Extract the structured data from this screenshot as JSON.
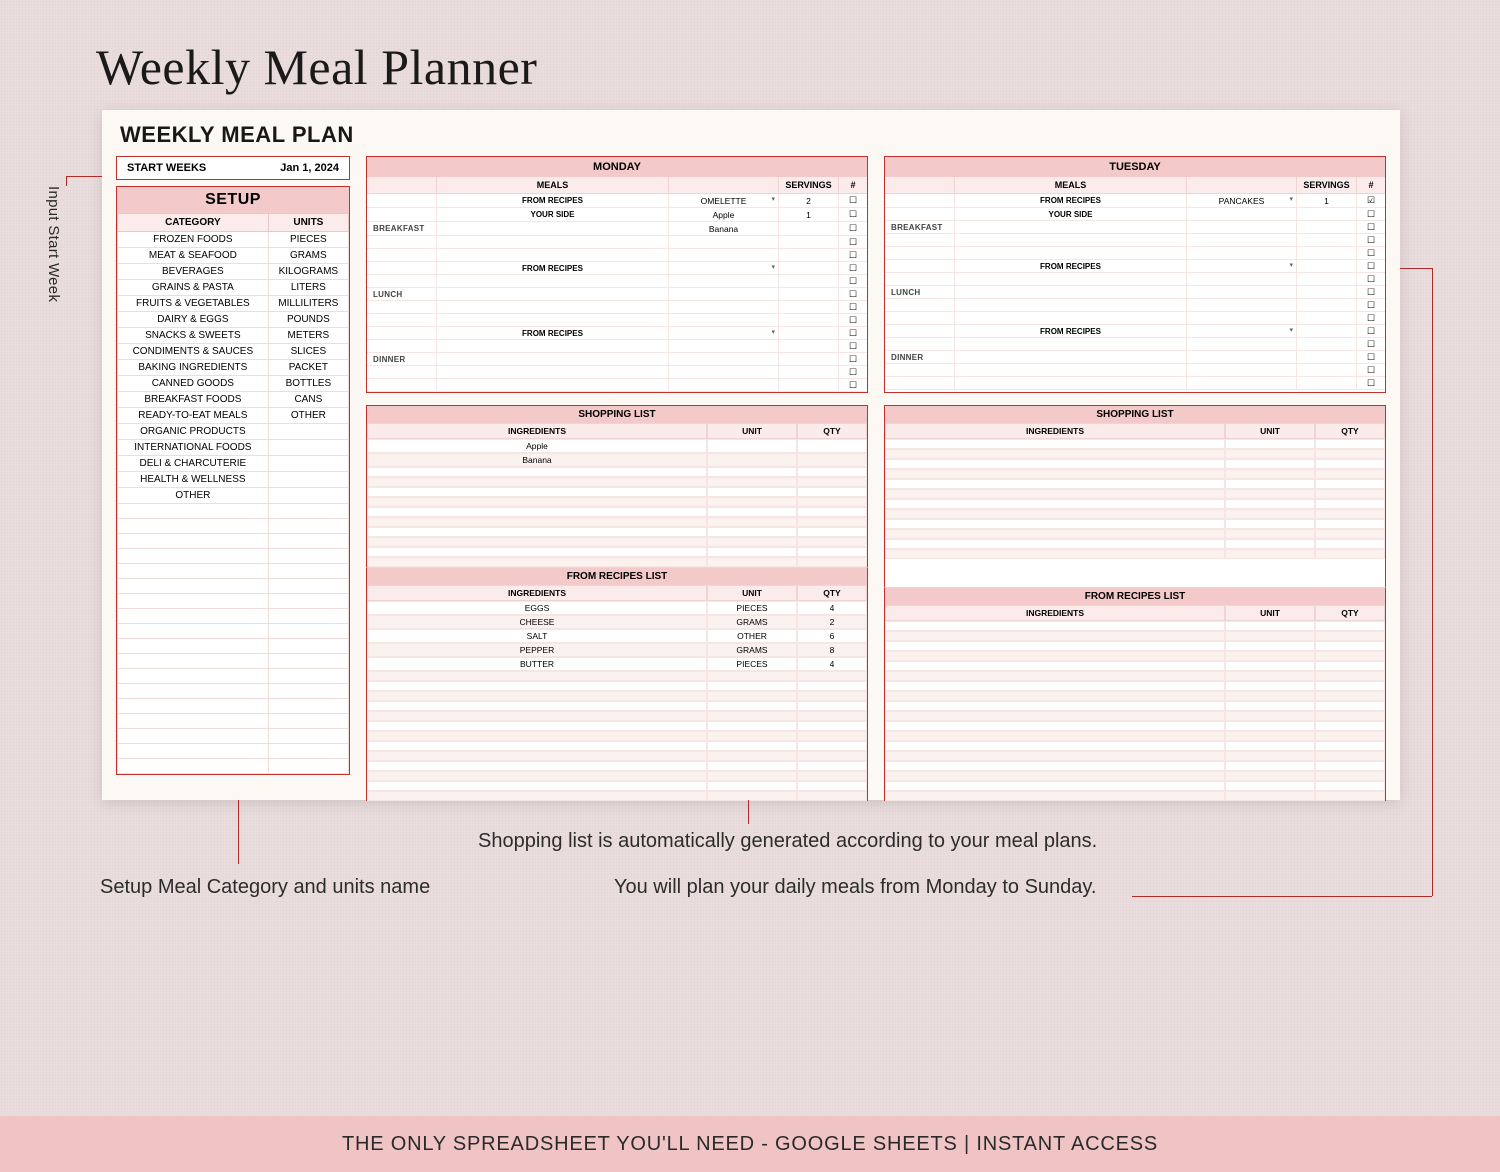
{
  "page": {
    "title": "Weekly Meal Planner",
    "sheet_title": "WEEKLY MEAL PLAN"
  },
  "start": {
    "label": "START WEEKS",
    "value": "Jan 1, 2024"
  },
  "setup": {
    "title": "SETUP",
    "cols": {
      "category": "CATEGORY",
      "units": "UNITS"
    },
    "rows": [
      {
        "category": "FROZEN FOODS",
        "units": "PIECES"
      },
      {
        "category": "MEAT & SEAFOOD",
        "units": "GRAMS"
      },
      {
        "category": "BEVERAGES",
        "units": "KILOGRAMS"
      },
      {
        "category": "GRAINS & PASTA",
        "units": "LITERS"
      },
      {
        "category": "FRUITS & VEGETABLES",
        "units": "MILLILITERS"
      },
      {
        "category": "DAIRY & EGGS",
        "units": "POUNDS"
      },
      {
        "category": "SNACKS & SWEETS",
        "units": "METERS"
      },
      {
        "category": "CONDIMENTS & SAUCES",
        "units": "SLICES"
      },
      {
        "category": "BAKING INGREDIENTS",
        "units": "PACKET"
      },
      {
        "category": "CANNED GOODS",
        "units": "BOTTLES"
      },
      {
        "category": "BREAKFAST FOODS",
        "units": "CANS"
      },
      {
        "category": "READY-TO-EAT MEALS",
        "units": "OTHER"
      },
      {
        "category": "ORGANIC PRODUCTS",
        "units": ""
      },
      {
        "category": "INTERNATIONAL FOODS",
        "units": ""
      },
      {
        "category": "DELI & CHARCUTERIE",
        "units": ""
      },
      {
        "category": "HEALTH & WELLNESS",
        "units": ""
      },
      {
        "category": "OTHER",
        "units": ""
      }
    ]
  },
  "meals_header": {
    "meals": "MEALS",
    "servings": "SERVINGS",
    "done": "#"
  },
  "meal_labels": {
    "breakfast": "BREAKFAST",
    "lunch": "LUNCH",
    "dinner": "DINNER",
    "from_recipes": "FROM RECIPES",
    "your_side": "YOUR SIDE"
  },
  "days": {
    "monday": {
      "name": "MONDAY",
      "breakfast": {
        "recipe": "OMELETTE",
        "servings": "2",
        "sides": [
          "Apple",
          "Banana"
        ],
        "side_servings": "1"
      },
      "checks": [
        "☐",
        "☐",
        "☐",
        "☐",
        "☐",
        "☐",
        "☐",
        "☐",
        "☐",
        "☐",
        "☐",
        "☐",
        "☐",
        "☐",
        "☐"
      ]
    },
    "tuesday": {
      "name": "TUESDAY",
      "breakfast": {
        "recipe": "PANCAKES",
        "servings": "1",
        "sides": [
          "",
          ""
        ],
        "side_servings": ""
      },
      "checks": [
        "☑",
        "☐",
        "☐",
        "☐",
        "☐",
        "☐",
        "☐",
        "☐",
        "☐",
        "☐",
        "☐",
        "☐",
        "☐",
        "☐",
        "☐"
      ]
    }
  },
  "shopping": {
    "title": "SHOPPING LIST",
    "cols": {
      "ing": "INGREDIENTS",
      "unit": "UNIT",
      "qty": "QTY"
    },
    "monday": [
      {
        "ing": "Apple",
        "unit": "",
        "qty": ""
      },
      {
        "ing": "Banana",
        "unit": "",
        "qty": ""
      }
    ],
    "tuesday": []
  },
  "from_recipes": {
    "title": "FROM RECIPES LIST",
    "cols": {
      "ing": "INGREDIENTS",
      "unit": "UNIT",
      "qty": "QTY"
    },
    "monday": [
      {
        "ing": "EGGS",
        "unit": "PIECES",
        "qty": "4"
      },
      {
        "ing": "CHEESE",
        "unit": "GRAMS",
        "qty": "2"
      },
      {
        "ing": "SALT",
        "unit": "OTHER",
        "qty": "6"
      },
      {
        "ing": "PEPPER",
        "unit": "GRAMS",
        "qty": "8"
      },
      {
        "ing": "BUTTER",
        "unit": "PIECES",
        "qty": "4"
      }
    ],
    "tuesday": []
  },
  "callouts": {
    "left": "Input Start Week",
    "setup": "Setup Meal Category and units name",
    "shopping": "Shopping list is automatically generated according to your meal plans.",
    "daily": "You will plan your daily meals from Monday to Sunday."
  },
  "footer": "THE ONLY SPREADSHEET YOU'LL NEED - GOOGLE SHEETS | INSTANT ACCESS"
}
